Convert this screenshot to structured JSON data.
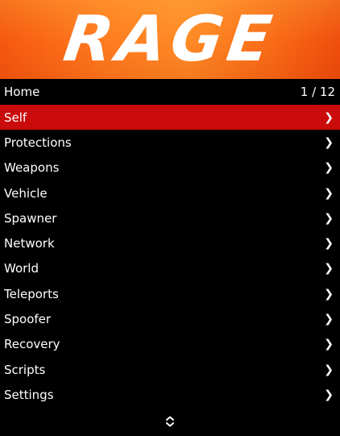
{
  "banner": {
    "logo_text": "RAGE",
    "colors": {
      "start": "#f5570f",
      "mid": "#ff8a25",
      "end": "#ef4d0c"
    }
  },
  "header": {
    "title": "Home",
    "page_counter": "1 / 12"
  },
  "menu": {
    "selected_index": 0,
    "highlight_color": "#c90b0b",
    "chevron_icon": "chevron-right-icon",
    "items": [
      {
        "label": "Self"
      },
      {
        "label": "Protections"
      },
      {
        "label": "Weapons"
      },
      {
        "label": "Vehicle"
      },
      {
        "label": "Spawner"
      },
      {
        "label": "Network"
      },
      {
        "label": "World"
      },
      {
        "label": "Teleports"
      },
      {
        "label": "Spoofer"
      },
      {
        "label": "Recovery"
      },
      {
        "label": "Scripts"
      },
      {
        "label": "Settings"
      }
    ]
  },
  "footer": {
    "icon": "scroll-up-down-icon"
  }
}
